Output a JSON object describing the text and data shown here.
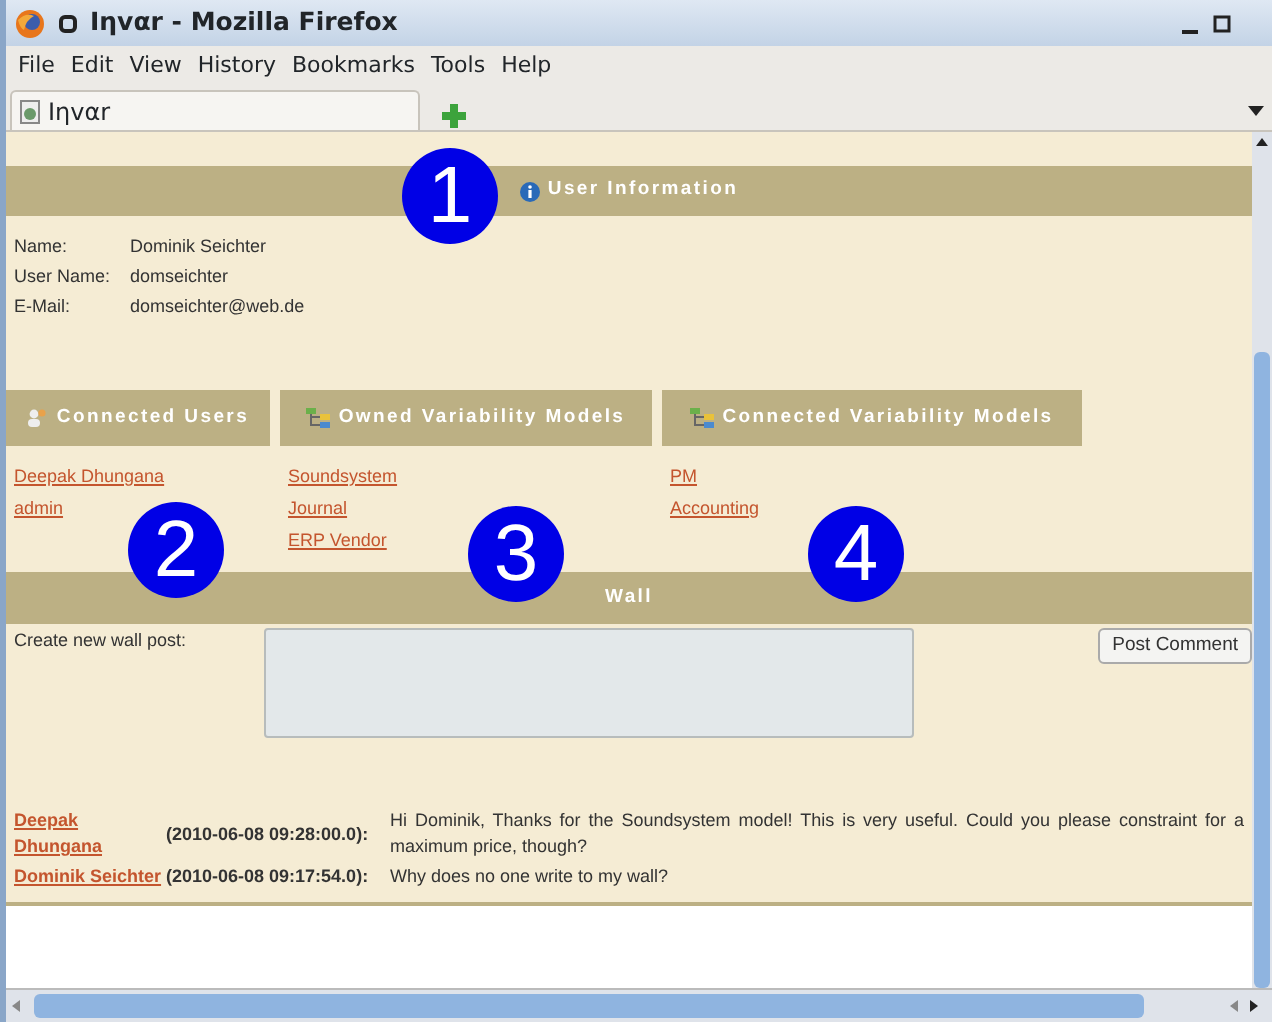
{
  "window": {
    "title": "Iηvαr - Mozilla Firefox"
  },
  "menu": [
    "File",
    "Edit",
    "View",
    "History",
    "Bookmarks",
    "Tools",
    "Help"
  ],
  "tabs": [
    {
      "label": "Iηvαr",
      "selected": true
    }
  ],
  "user_info": {
    "heading": "User Information",
    "fields": [
      {
        "label": "Name:",
        "value": "Dominik Seichter"
      },
      {
        "label": "User Name:",
        "value": "domseichter"
      },
      {
        "label": "E-Mail:",
        "value": "domseichter@web.de"
      }
    ]
  },
  "sections": [
    {
      "heading": "Connected Users",
      "kind": "users",
      "links": [
        "Deepak Dhungana",
        "admin"
      ]
    },
    {
      "heading": "Owned Variability Models",
      "kind": "models",
      "links": [
        "Soundsystem",
        "Journal",
        "ERP Vendor"
      ]
    },
    {
      "heading": "Connected Variability Models",
      "kind": "models",
      "links": [
        "PM",
        "Accounting"
      ]
    }
  ],
  "wall": {
    "heading": "Wall",
    "prompt": "Create new wall post:",
    "button": "Post Comment",
    "posts": [
      {
        "author": "Deepak Dhungana",
        "date": "(2010-06-08 09:28:00.0):",
        "message": "Hi Dominik, Thanks for the Soundsystem model! This is very useful. Could you please constraint for a maximum price, though?"
      },
      {
        "author": "Dominik Seichter",
        "date": "(2010-06-08 09:17:54.0):",
        "message": "Why does no one write to my wall?"
      }
    ]
  },
  "callouts": [
    "1",
    "2",
    "3",
    "4"
  ]
}
